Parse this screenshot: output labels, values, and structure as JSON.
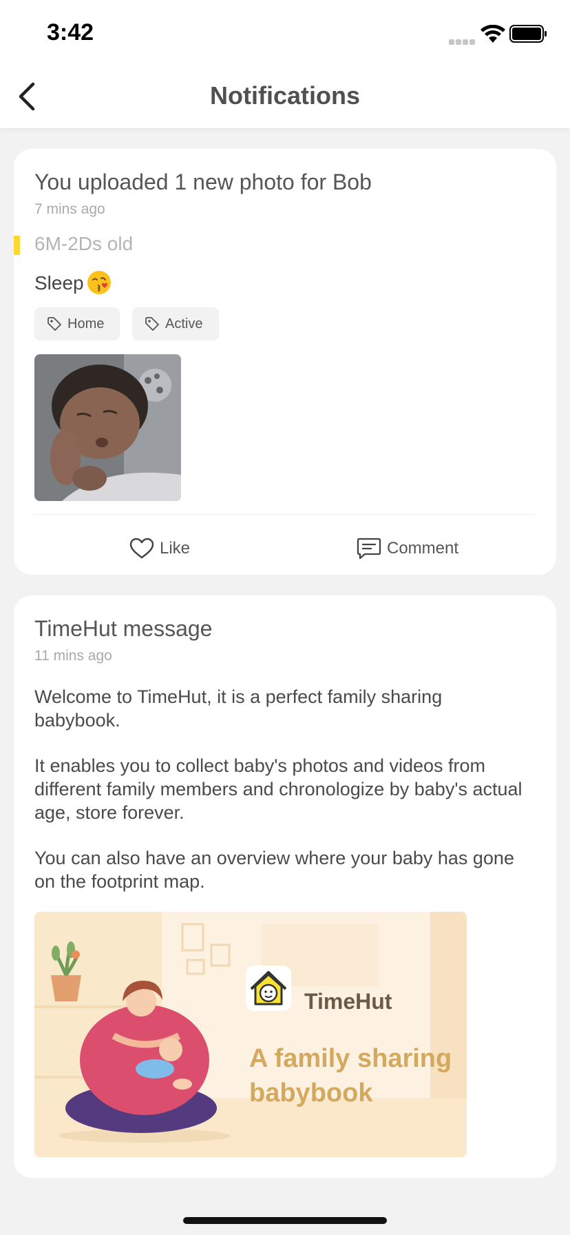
{
  "status_bar": {
    "time": "3:42"
  },
  "nav": {
    "title": "Notifications"
  },
  "upload_card": {
    "title": "You uploaded 1 new photo for Bob",
    "time": "7 mins ago",
    "age": "6M-2Ds old",
    "caption": "Sleep",
    "tags": [
      "Home",
      "Active"
    ],
    "like_label": "Like",
    "comment_label": "Comment"
  },
  "message_card": {
    "title": "TimeHut message",
    "time": "11 mins ago",
    "paragraphs": [
      "Welcome to TimeHut, it is a perfect family sharing babybook.",
      "It enables you to collect baby's photos and videos from different family members and chronologize by baby's actual age, store forever.",
      "You can also have an overview where your baby has gone on the footprint map."
    ],
    "banner": {
      "brand": "TimeHut",
      "tagline": "A family sharing babybook"
    }
  },
  "colors": {
    "accent_yellow": "#fbd832",
    "banner_text": "#d4a85d",
    "background": "#f2f2f2"
  },
  "icons": [
    "chevron-left-icon",
    "signal-icon",
    "wifi-icon",
    "battery-icon",
    "tag-icon",
    "heart-icon",
    "comment-icon",
    "kiss-emoji-icon",
    "timehut-logo-icon"
  ]
}
